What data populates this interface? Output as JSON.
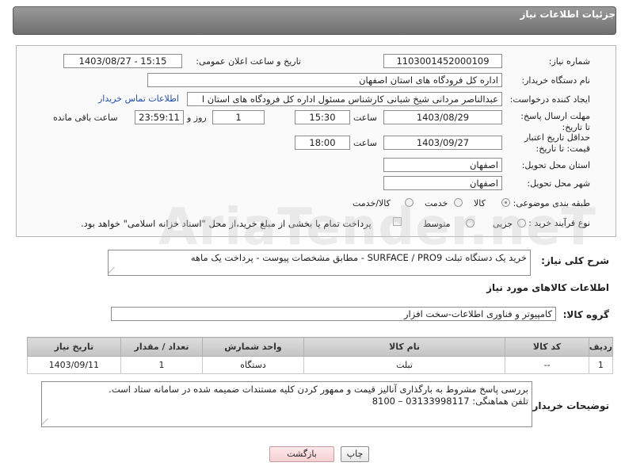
{
  "header": {
    "title": "جزئیات اطلاعات نیاز"
  },
  "form": {
    "need_number_label": "شماره نیاز:",
    "need_number": "1103001452000109",
    "announce_label": "تاریخ و ساعت اعلان عمومی:",
    "announce_value": "1403/08/27 - 15:15",
    "buyer_org_label": "نام دستگاه خریدار:",
    "buyer_org": "اداره کل فرودگاه های استان اصفهان",
    "creator_label": "ایجاد کننده درخواست:",
    "creator": "عبدالناصر مردانی شیخ شبانی کارشناس مسئول  اداره کل فرودگاه های استان ا",
    "contact_link": "اطلاعات تماس خریدار",
    "reply_deadline_label": "مهلت ارسال پاسخ: تا تاریخ:",
    "reply_date": "1403/08/29",
    "time_label": "ساعت",
    "reply_time": "15:30",
    "days_value": "1",
    "days_label": "روز و",
    "remaining_time": "23:59:11",
    "remaining_label": "ساعت باقی مانده",
    "price_validity_label": "حداقل تاریخ اعتبار قیمت: تا تاریخ:",
    "price_date": "1403/09/27",
    "price_time": "18:00",
    "province_label": "استان محل تحویل:",
    "province": "اصفهان",
    "city_label": "شهر محل تحویل:",
    "city": "اصفهان",
    "category_label": "طبقه بندی موضوعی:",
    "category_options": [
      "کالا",
      "خدمت",
      "کالا/خدمت"
    ],
    "process_label": "نوع فرآیند خرید :",
    "process_options": [
      "جزیی",
      "متوسط"
    ],
    "payment_note": "پرداخت تمام یا بخشی از مبلغ خرید،از محل \"اسناد خزانه اسلامی\" خواهد بود."
  },
  "summary": {
    "label": "شرح کلی نیاز:",
    "text": "خرید یک دستگاه تبلت SURFACE / PRO9 - مطابق مشخصات پیوست - پرداخت یک ماهه"
  },
  "goods": {
    "section_title": "اطلاعات کالاهای مورد نیاز",
    "group_label": "گروه کالا:",
    "group_value": "کامپیوتر و فناوری اطلاعات-سخت افزار",
    "columns": [
      "ردیف",
      "کد کالا",
      "نام کالا",
      "واحد شمارش",
      "تعداد / مقدار",
      "تاریخ نیاز"
    ],
    "rows": [
      {
        "row": "1",
        "code": "--",
        "name": "تبلت",
        "unit": "دستگاه",
        "qty": "1",
        "date": "1403/09/11"
      }
    ]
  },
  "buyer_notes": {
    "label": "توضیحات خریدار:",
    "line1": "بررسی پاسخ مشروط  به بارگذاری آنالیز قیمت  و ممهور کردن کلیه مستندات ضمیمه شده در سامانه  ستاد است.",
    "line2": "تلفن هماهنگی: 03133998117 – 8100"
  },
  "buttons": {
    "print": "چاپ",
    "back": "بازگشت"
  },
  "watermark": "AriaTender.neT"
}
